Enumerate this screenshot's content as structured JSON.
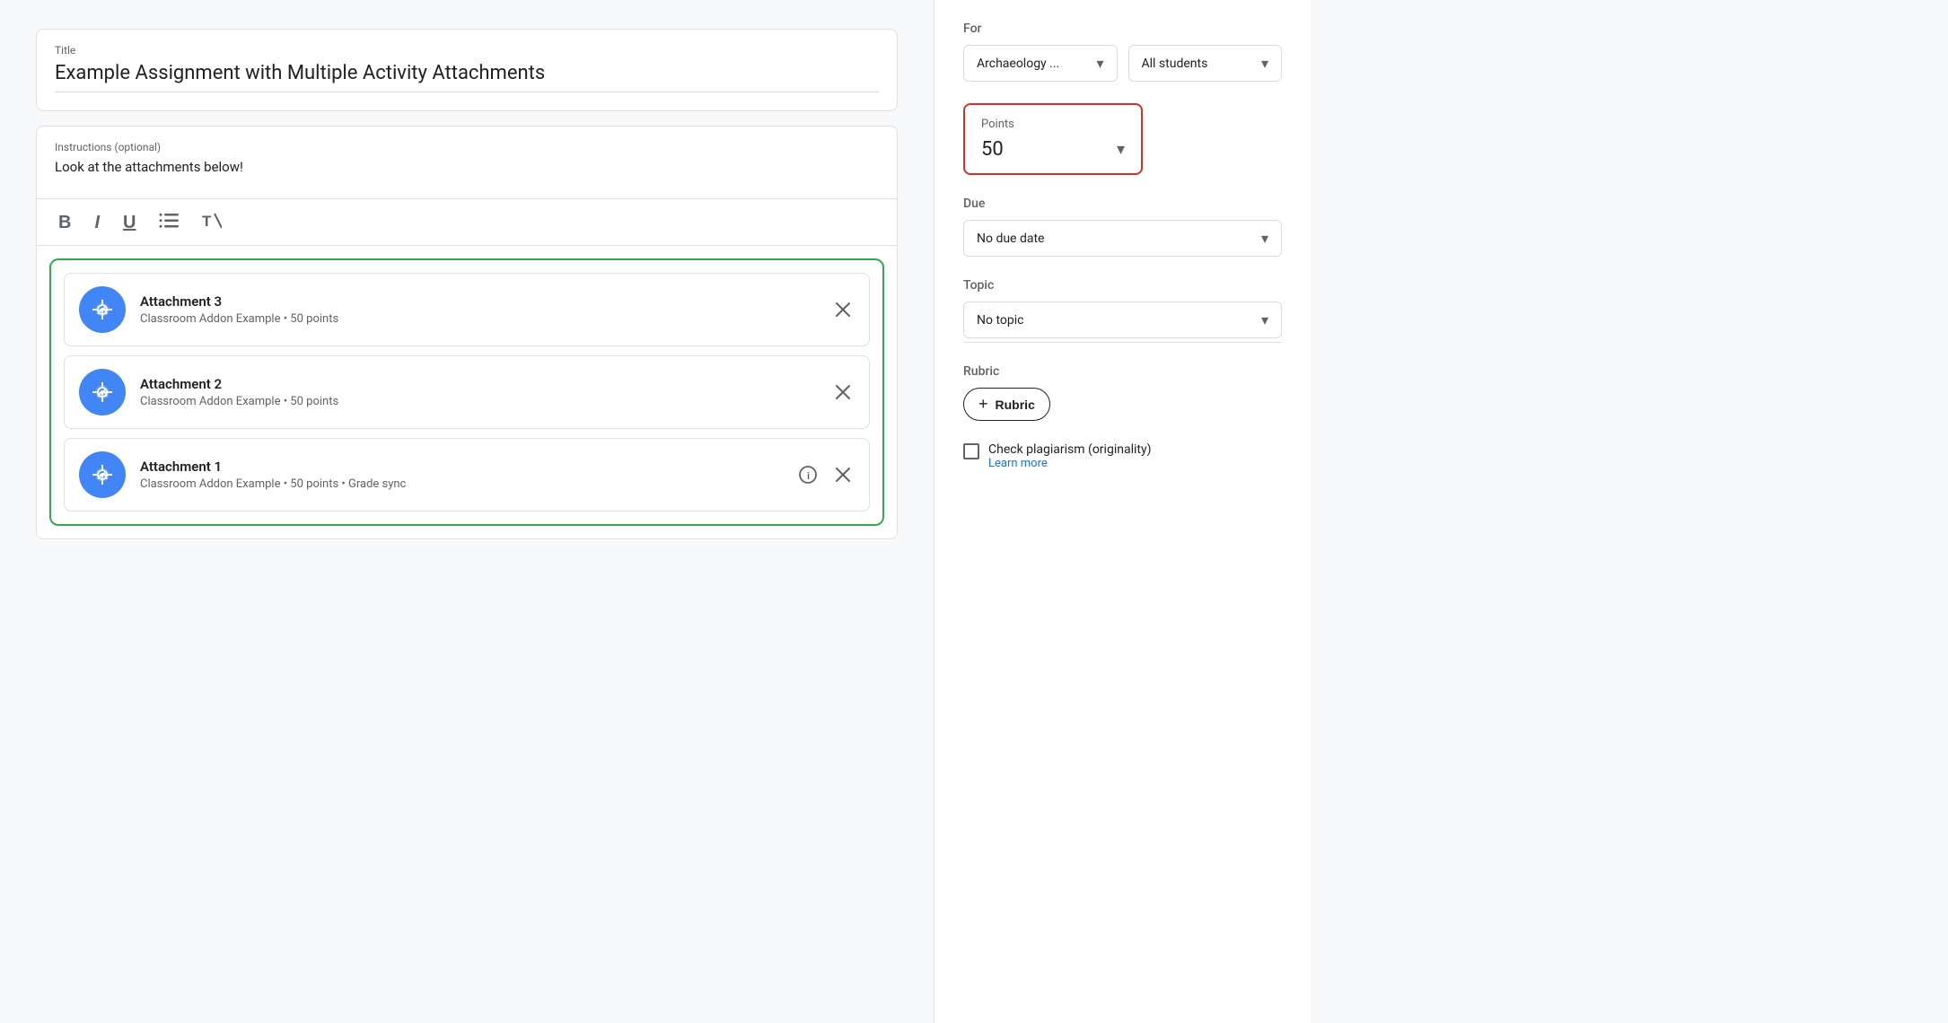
{
  "title_section": {
    "label": "Title",
    "value": "Example Assignment with Multiple Activity Attachments"
  },
  "instructions_section": {
    "label": "Instructions (optional)",
    "value": "Look at the attachments below!"
  },
  "toolbar": {
    "bold": "B",
    "italic": "I",
    "underline": "U",
    "list": "≡",
    "clear": "✕"
  },
  "attachments": [
    {
      "id": "attachment-3",
      "name": "Attachment 3",
      "meta": "Classroom Addon Example • 50 points",
      "show_info": false
    },
    {
      "id": "attachment-2",
      "name": "Attachment 2",
      "meta": "Classroom Addon Example • 50 points",
      "show_info": false
    },
    {
      "id": "attachment-1",
      "name": "Attachment 1",
      "meta": "Classroom Addon Example • 50 points • Grade sync",
      "show_info": true
    }
  ],
  "side_panel": {
    "for_label": "For",
    "class_dropdown": "Archaeology ...",
    "students_dropdown": "All students",
    "points_label": "Points",
    "points_value": "50",
    "due_label": "Due",
    "due_value": "No due date",
    "topic_label": "Topic",
    "topic_value": "No topic",
    "rubric_label": "Rubric",
    "rubric_btn": "Rubric",
    "rubric_plus": "+",
    "plagiarism_label": "Check plagiarism (originality)",
    "learn_more": "Learn more"
  },
  "colors": {
    "green_border": "#34a853",
    "red_border": "#d93025",
    "blue_icon": "#4285f4",
    "blue_link": "#1a73e8"
  }
}
